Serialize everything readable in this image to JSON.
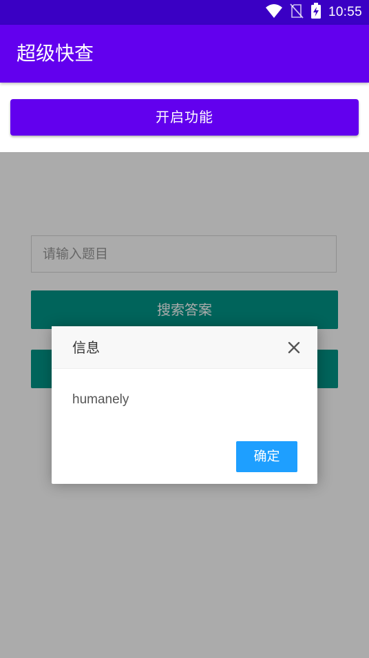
{
  "status_bar": {
    "time": "10:55",
    "icons": [
      "wifi-icon",
      "no-sim-icon",
      "battery-charging-icon"
    ]
  },
  "app_bar": {
    "title": "超级快查"
  },
  "main": {
    "enable_button_label": "开启功能",
    "question_input": {
      "placeholder": "请输入题目",
      "value": ""
    },
    "search_button_label": "搜索答案",
    "second_button_label": ""
  },
  "dialog": {
    "title": "信息",
    "close_icon": "close-icon",
    "message": "humanely",
    "ok_label": "确定"
  },
  "colors": {
    "status_bar": "#3a00c4",
    "primary": "#6200ee",
    "teal": "#009688",
    "dialog_button": "#1e9fff",
    "overlay": "rgba(0,0,0,0.33)"
  }
}
